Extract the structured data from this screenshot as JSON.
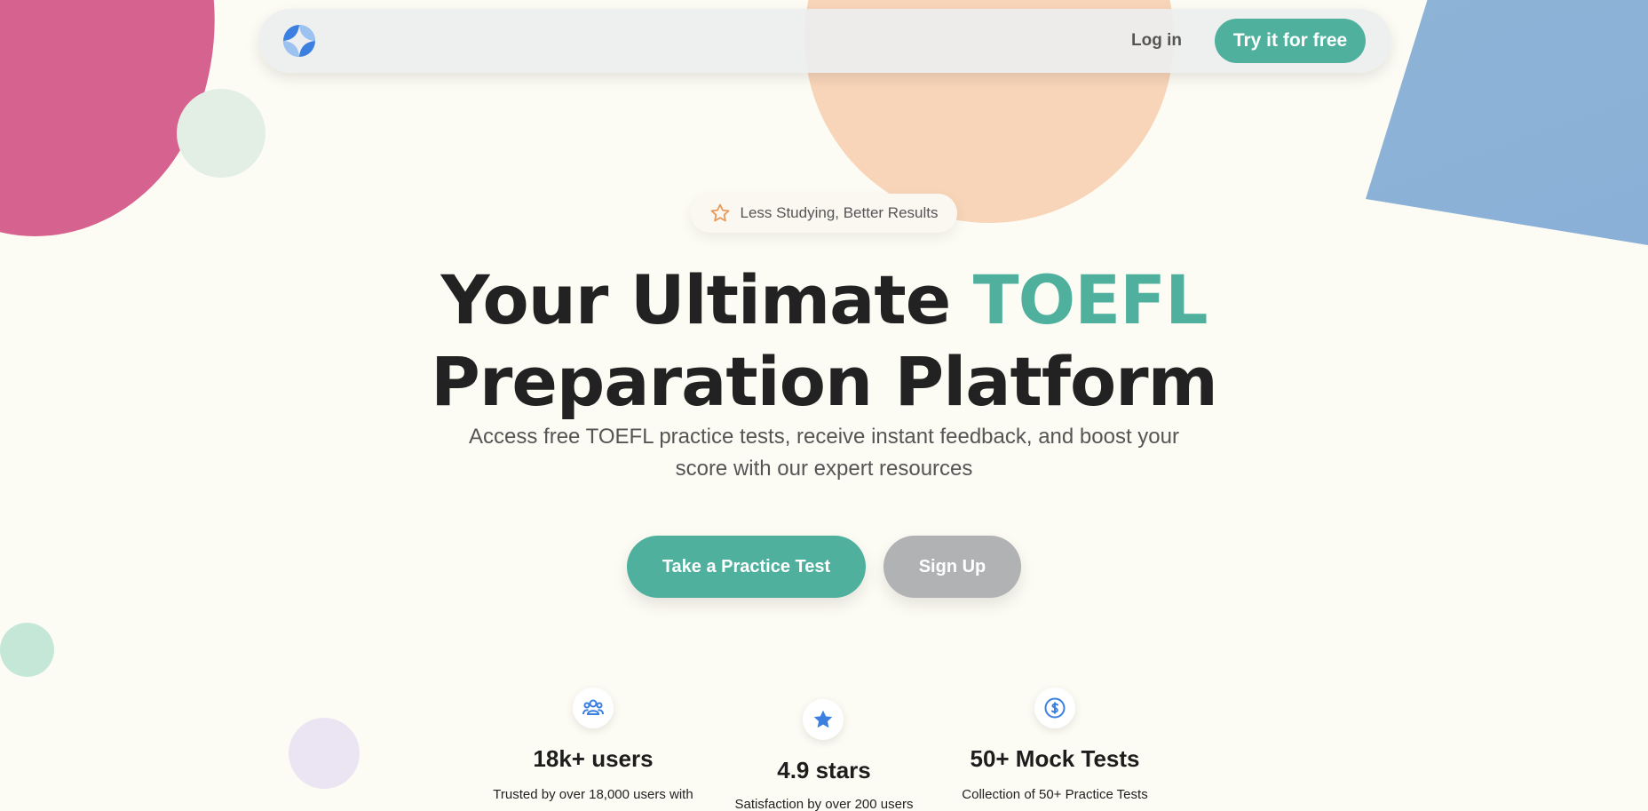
{
  "nav": {
    "login_label": "Log in",
    "try_label": "Try it for free"
  },
  "hero": {
    "badge": "Less Studying, Better Results",
    "headline_part1": "Your Ultimate ",
    "headline_accent": "TOEFL",
    "headline_part2": "Preparation Platform",
    "subtitle_line1": "Access free TOEFL practice tests, receive instant feedback, and boost your",
    "subtitle_line2": "score with our expert resources",
    "primary_button": "Take a Practice Test",
    "secondary_button": "Sign Up"
  },
  "stats": [
    {
      "icon": "users-icon",
      "title": "18k+ users",
      "description": "Trusted by over 18,000 users with"
    },
    {
      "icon": "star-icon",
      "title": "4.9 stars",
      "description": "Satisfaction by over 200 users"
    },
    {
      "icon": "dollar-icon",
      "title": "50+ Mock Tests",
      "description": "Collection of 50+ Practice Tests"
    }
  ],
  "colors": {
    "accent": "#4fb09e",
    "background": "#fdfcf4",
    "icon_blue": "#3b7fe0",
    "star_orange": "#e89a5a"
  }
}
